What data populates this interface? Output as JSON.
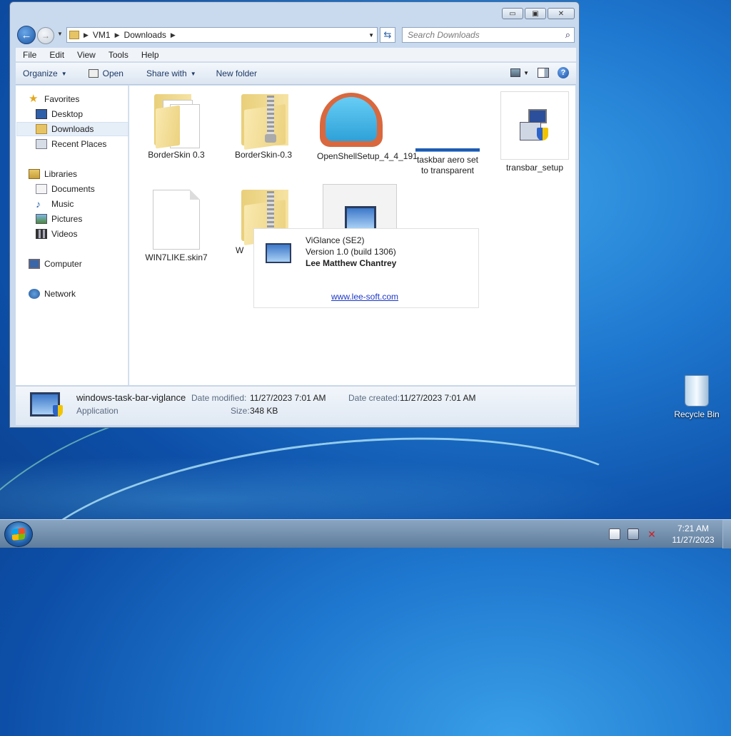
{
  "window": {
    "minimize_glyph": "▭",
    "maximize_glyph": "▣",
    "close_glyph": "✕"
  },
  "address": {
    "crumbs": [
      "VM1",
      "Downloads"
    ],
    "search_placeholder": "Search Downloads"
  },
  "menubar": [
    "File",
    "Edit",
    "View",
    "Tools",
    "Help"
  ],
  "commandbar": {
    "organize": "Organize",
    "open": "Open",
    "share_with": "Share with",
    "new_folder": "New folder"
  },
  "navpane": {
    "favorites": "Favorites",
    "desktop": "Desktop",
    "downloads": "Downloads",
    "recent": "Recent Places",
    "libraries": "Libraries",
    "documents": "Documents",
    "music": "Music",
    "pictures": "Pictures",
    "videos": "Videos",
    "computer": "Computer",
    "network": "Network"
  },
  "files": {
    "f1": "BorderSkin 0.3",
    "f2": "BorderSkin-0.3",
    "f3": "OpenShellSetup_4_4_191",
    "f4": "taskbar aero set to transparent",
    "f5": "transbar_setup",
    "f6": "WIN7LIKE.skin7",
    "f7": "W"
  },
  "tooltip": {
    "name": "ViGlance (SE2)",
    "version": "Version 1.0 (build 1306)",
    "author": "Lee Matthew Chantrey",
    "link": "www.lee-soft.com"
  },
  "details": {
    "filename": "windows-task-bar-viglance",
    "type": "Application",
    "date_modified_label": "Date modified:",
    "date_modified": "11/27/2023 7:01 AM",
    "date_created_label": "Date created:",
    "date_created": "11/27/2023 7:01 AM",
    "size_label": "Size:",
    "size": "348 KB"
  },
  "desktop": {
    "recycle_bin": "Recycle Bin"
  },
  "taskbar": {
    "time": "7:21 AM",
    "date": "11/27/2023"
  }
}
